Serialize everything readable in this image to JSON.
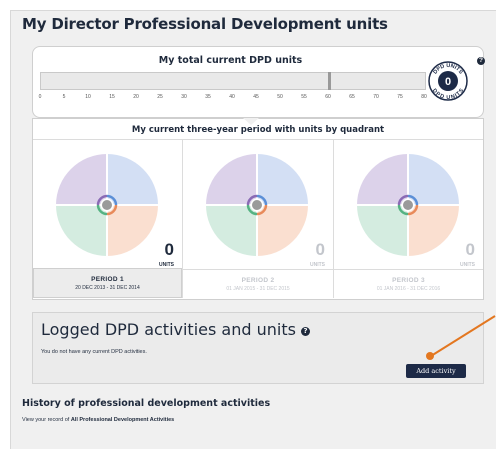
{
  "page": {
    "title": "My Director Professional Development units"
  },
  "total_units": {
    "title": "My total current DPD units",
    "scale_ticks": [
      "0",
      "5",
      "10",
      "15",
      "20",
      "25",
      "30",
      "35",
      "40",
      "45",
      "50",
      "55",
      "60",
      "65",
      "70",
      "75",
      "80"
    ],
    "scale_max": 80,
    "current_value": 0,
    "target_value": 60,
    "badge": {
      "top_text": "DPD UNITS",
      "value": "0",
      "bottom_text": "DPD UNITS"
    },
    "help_icon": "question-icon"
  },
  "quadrants": {
    "title": "My current three-year period with units by quadrant",
    "quadrant_colors": [
      "#dcd2ea",
      "#d3dff4",
      "#d4ece0",
      "#fadfd0"
    ],
    "periods": [
      {
        "units": "0",
        "units_label": "UNITS",
        "name": "PERIOD 1",
        "dates": "20 DEC 2013 - 31 DEC 2014",
        "active": true
      },
      {
        "units": "0",
        "units_label": "UNITS",
        "name": "PERIOD 2",
        "dates": "01 JAN 2015 - 31 DEC 2015",
        "active": false
      },
      {
        "units": "0",
        "units_label": "UNITS",
        "name": "PERIOD 3",
        "dates": "01 JAN 2016 - 31 DEC 2016",
        "active": false
      }
    ]
  },
  "logged": {
    "title": "Logged DPD activities and units",
    "message": "You do not have any current DPD activities.",
    "add_button": "Add activity",
    "help_icon": "question-icon"
  },
  "history": {
    "title": "History of professional development activities",
    "prefix": "View your record of",
    "link": "All Professional Development Activities"
  },
  "colors": {
    "navy": "#1d2a47",
    "highlight": "#e37720"
  }
}
